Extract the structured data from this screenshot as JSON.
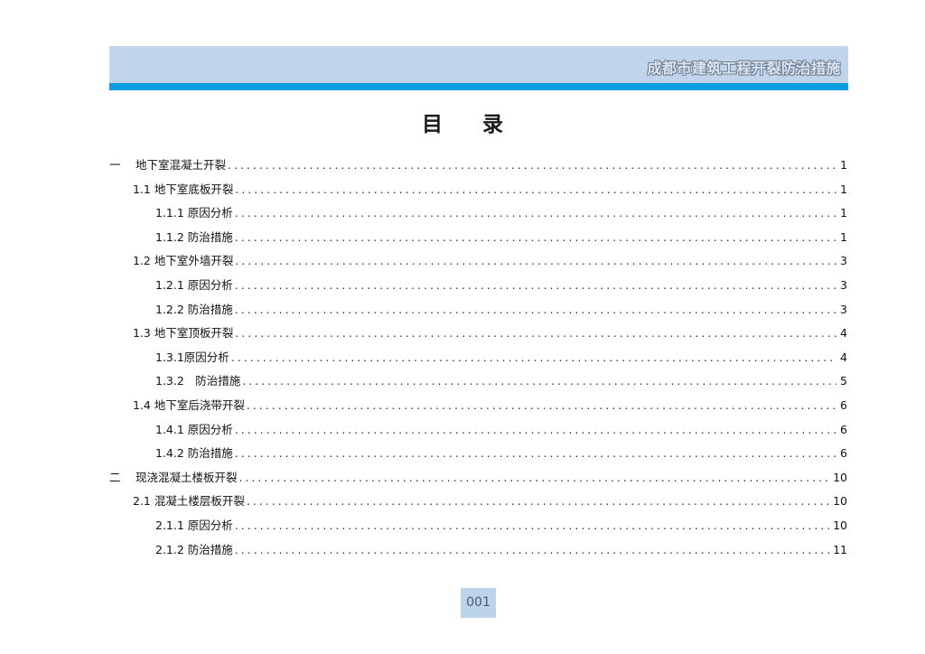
{
  "header": {
    "title": "成都市建筑工程开裂防治措施"
  },
  "toc_title": "目录",
  "toc": [
    {
      "label": "一　 地下室混凝土开裂",
      "page": "1",
      "level": 0
    },
    {
      "label": "1.1 地下室底板开裂",
      "page": "1",
      "level": 1
    },
    {
      "label": "1.1.1 原因分析",
      "page": "1",
      "level": 2
    },
    {
      "label": "1.1.2 防治措施",
      "page": "1",
      "level": 2
    },
    {
      "label": "1.2 地下室外墙开裂",
      "page": "3",
      "level": 1
    },
    {
      "label": "1.2.1 原因分析",
      "page": "3",
      "level": 2
    },
    {
      "label": "1.2.2 防治措施",
      "page": "3",
      "level": 2
    },
    {
      "label": "1.3 地下室顶板开裂",
      "page": "4",
      "level": 1
    },
    {
      "label": "1.3.1原因分析",
      "page": "4",
      "level": 2
    },
    {
      "label": "1.3.2　防治措施",
      "page": "5",
      "level": 2
    },
    {
      "label": "1.4 地下室后浇带开裂",
      "page": "6",
      "level": 1
    },
    {
      "label": "1.4.1 原因分析",
      "page": "6",
      "level": 2
    },
    {
      "label": "1.4.2 防治措施",
      "page": "6",
      "level": 2
    },
    {
      "label": "二　 现浇混凝土楼板开裂",
      "page": "10",
      "level": 0
    },
    {
      "label": "2.1 混凝土楼层板开裂",
      "page": "10",
      "level": 1
    },
    {
      "label": "2.1.1 原因分析",
      "page": "10",
      "level": 2
    },
    {
      "label": "2.1.2 防治措施",
      "page": "11",
      "level": 2
    }
  ],
  "footer": {
    "page_number": "001"
  }
}
